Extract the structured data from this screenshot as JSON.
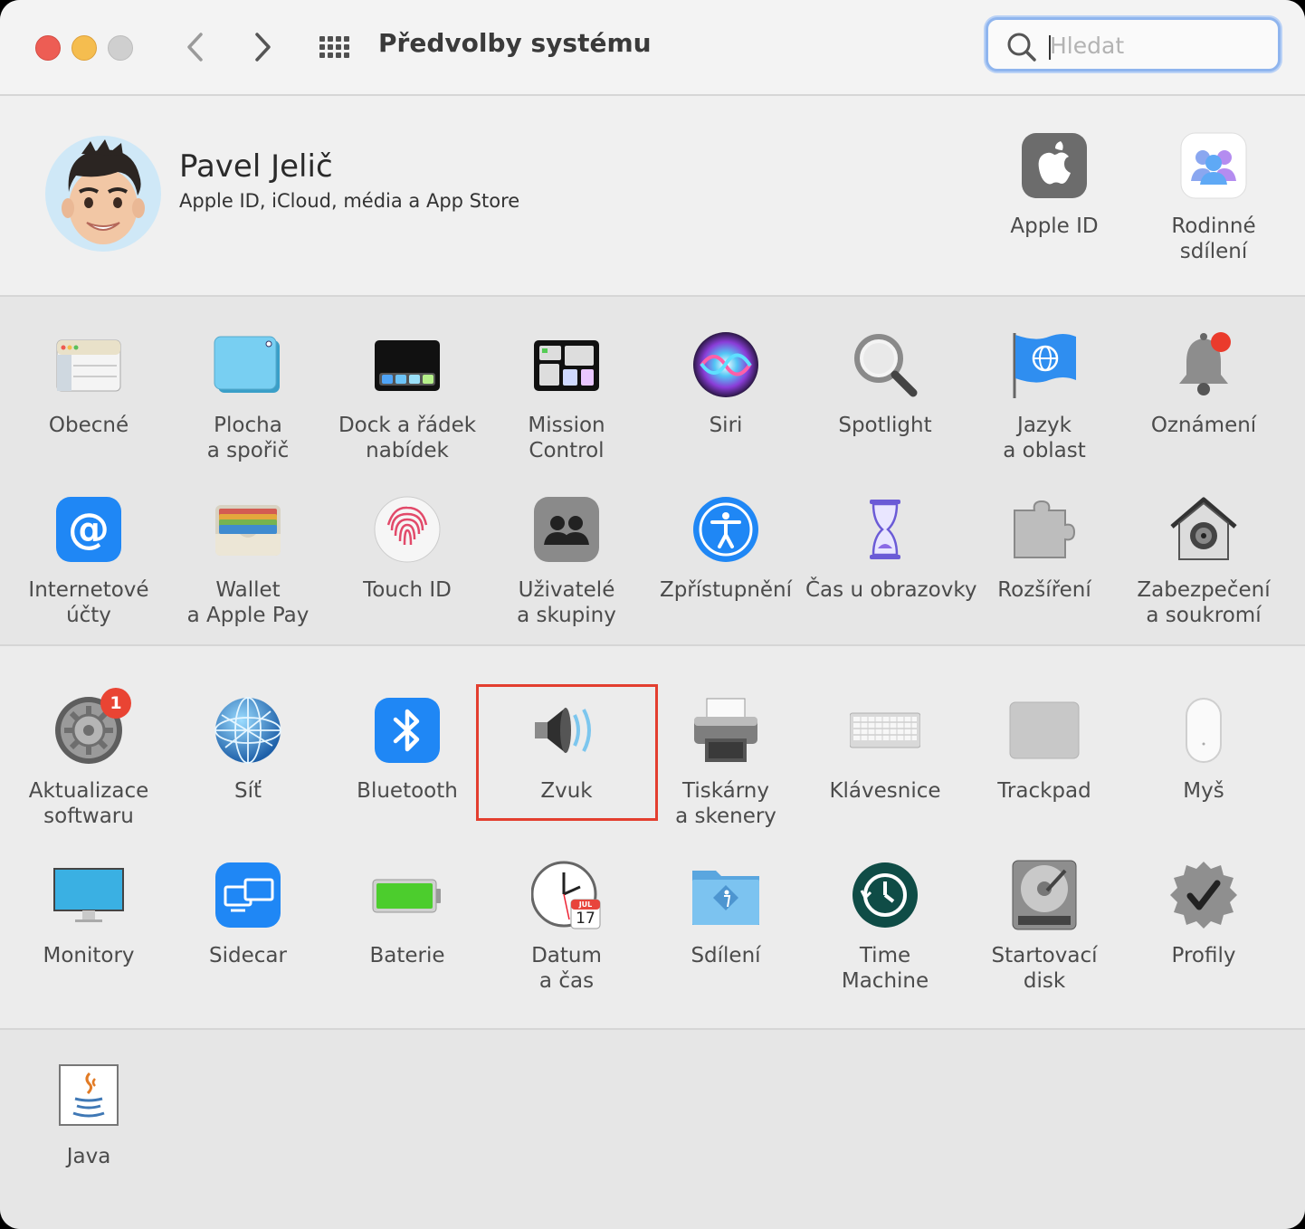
{
  "window": {
    "title": "Předvolby systému",
    "search_placeholder": "Hledat"
  },
  "account": {
    "name": "Pavel Jelič",
    "subtitle": "Apple ID, iCloud, média a App Store",
    "tiles": [
      {
        "id": "apple-id",
        "line1": "Apple ID",
        "line2": "",
        "icon": "apple-logo-icon"
      },
      {
        "id": "family-sharing",
        "line1": "Rodinné",
        "line2": "sdílení",
        "icon": "family-icon"
      }
    ]
  },
  "rows": [
    [
      {
        "id": "general",
        "line1": "Obecné",
        "line2": "",
        "icon": "general-icon"
      },
      {
        "id": "desktop-screensaver",
        "line1": "Plocha",
        "line2": "a spořič",
        "icon": "desktop-icon"
      },
      {
        "id": "dock-menubar",
        "line1": "Dock a řádek",
        "line2": "nabídek",
        "icon": "dock-icon"
      },
      {
        "id": "mission-control",
        "line1": "Mission",
        "line2": "Control",
        "icon": "mission-control-icon"
      },
      {
        "id": "siri",
        "line1": "Siri",
        "line2": "",
        "icon": "siri-icon"
      },
      {
        "id": "spotlight",
        "line1": "Spotlight",
        "line2": "",
        "icon": "magnifier-icon"
      },
      {
        "id": "language-region",
        "line1": "Jazyk",
        "line2": "a oblast",
        "icon": "globe-flag-icon"
      },
      {
        "id": "notifications",
        "line1": "Oznámení",
        "line2": "",
        "icon": "bell-icon"
      }
    ],
    [
      {
        "id": "internet-accounts",
        "line1": "Internetové",
        "line2": "účty",
        "icon": "at-icon"
      },
      {
        "id": "wallet",
        "line1": "Wallet",
        "line2": "a Apple Pay",
        "icon": "wallet-icon"
      },
      {
        "id": "touch-id",
        "line1": "Touch ID",
        "line2": "",
        "icon": "fingerprint-icon"
      },
      {
        "id": "users-groups",
        "line1": "Uživatelé",
        "line2": "a skupiny",
        "icon": "users-icon"
      },
      {
        "id": "accessibility",
        "line1": "Zpřístupnění",
        "line2": "",
        "icon": "accessibility-icon"
      },
      {
        "id": "screen-time",
        "line1": "Čas u obrazovky",
        "line2": "",
        "icon": "hourglass-icon"
      },
      {
        "id": "extensions",
        "line1": "Rozšíření",
        "line2": "",
        "icon": "puzzle-icon"
      },
      {
        "id": "security-privacy",
        "line1": "Zabezpečení",
        "line2": "a soukromí",
        "icon": "house-safe-icon"
      }
    ],
    [
      {
        "id": "software-update",
        "line1": "Aktualizace",
        "line2": "softwaru",
        "icon": "gear-icon",
        "badge": "1"
      },
      {
        "id": "network",
        "line1": "Síť",
        "line2": "",
        "icon": "network-globe-icon"
      },
      {
        "id": "bluetooth",
        "line1": "Bluetooth",
        "line2": "",
        "icon": "bluetooth-icon"
      },
      {
        "id": "sound",
        "line1": "Zvuk",
        "line2": "",
        "icon": "speaker-icon"
      },
      {
        "id": "printers-scanners",
        "line1": "Tiskárny",
        "line2": "a skenery",
        "icon": "printer-icon"
      },
      {
        "id": "keyboard",
        "line1": "Klávesnice",
        "line2": "",
        "icon": "keyboard-icon"
      },
      {
        "id": "trackpad",
        "line1": "Trackpad",
        "line2": "",
        "icon": "trackpad-icon"
      },
      {
        "id": "mouse",
        "line1": "Myš",
        "line2": "",
        "icon": "mouse-icon"
      }
    ],
    [
      {
        "id": "displays",
        "line1": "Monitory",
        "line2": "",
        "icon": "monitor-icon"
      },
      {
        "id": "sidecar",
        "line1": "Sidecar",
        "line2": "",
        "icon": "sidecar-icon"
      },
      {
        "id": "battery",
        "line1": "Baterie",
        "line2": "",
        "icon": "battery-icon"
      },
      {
        "id": "date-time",
        "line1": "Datum",
        "line2": "a čas",
        "icon": "clock-icon",
        "cal_month": "JUL",
        "cal_day": "17"
      },
      {
        "id": "sharing",
        "line1": "Sdílení",
        "line2": "",
        "icon": "shared-folder-icon"
      },
      {
        "id": "time-machine",
        "line1": "Time",
        "line2": "Machine",
        "icon": "time-machine-icon"
      },
      {
        "id": "startup-disk",
        "line1": "Startovací",
        "line2": "disk",
        "icon": "hard-disk-icon"
      },
      {
        "id": "profiles",
        "line1": "Profily",
        "line2": "",
        "icon": "checkmark-badge-icon"
      }
    ]
  ],
  "other": [
    {
      "id": "java",
      "line1": "Java",
      "line2": "",
      "icon": "java-cup-icon"
    }
  ],
  "selected": "sound",
  "colors": {
    "highlight": "#e33e2f",
    "badge": "#e94433",
    "search_focus": "#8fb5ee"
  }
}
